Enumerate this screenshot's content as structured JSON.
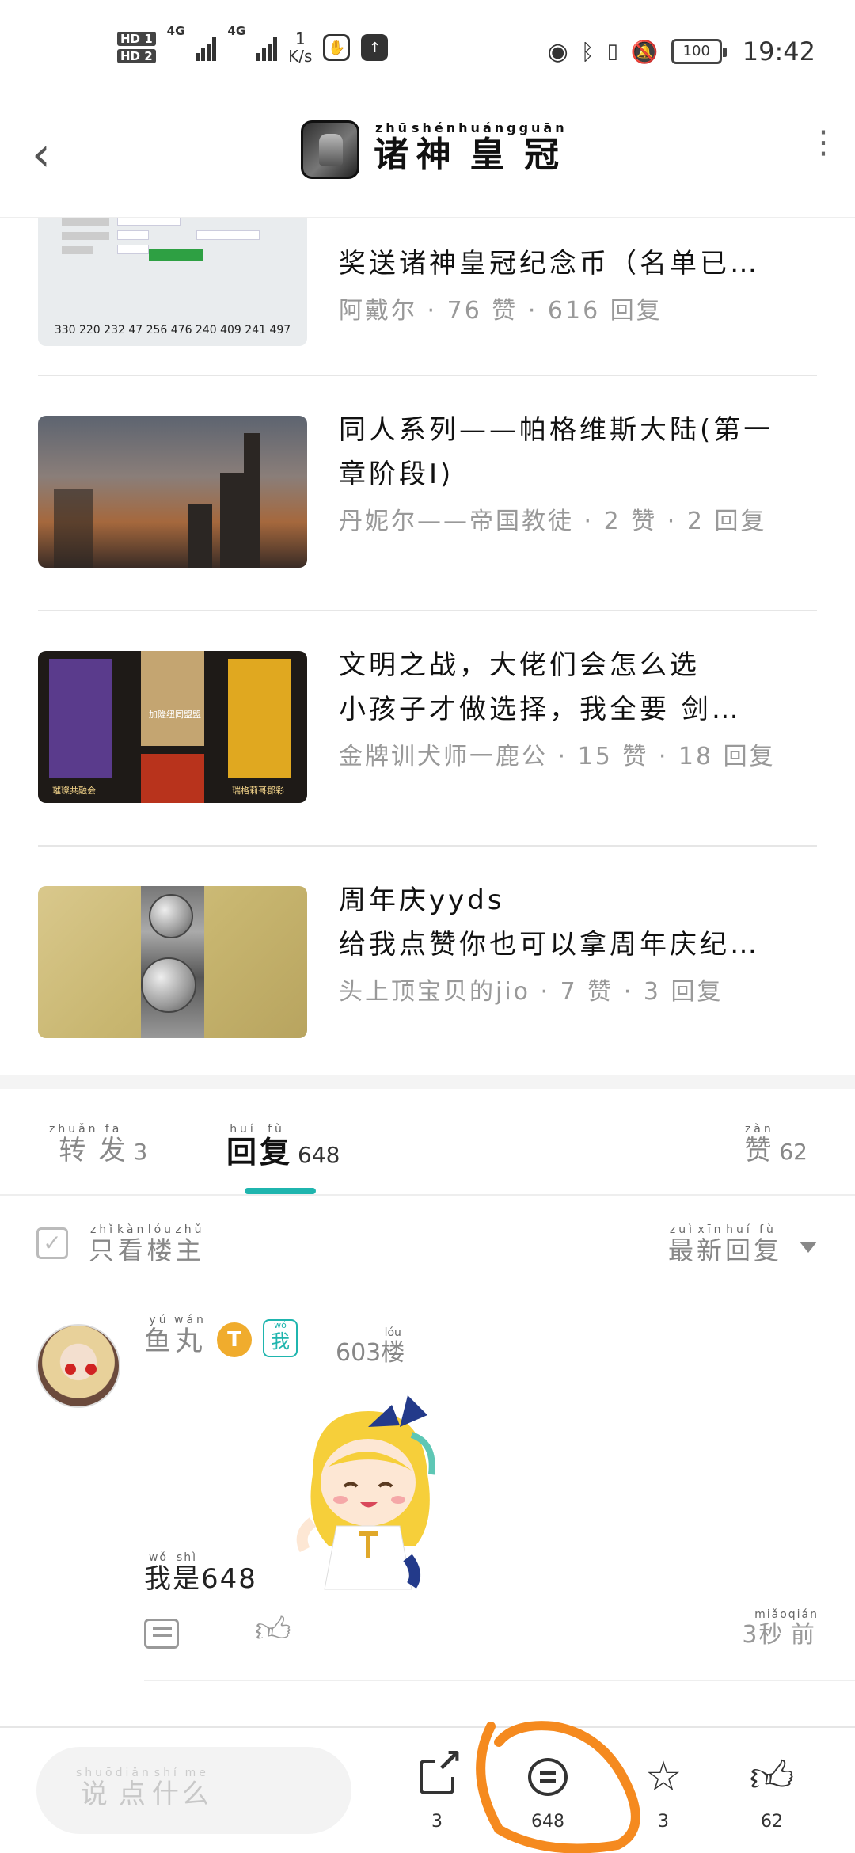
{
  "status_bar": {
    "hd1": "HD 1",
    "hd2": "HD 2",
    "net1": "4G",
    "net2": "4G",
    "speed_value": "1",
    "speed_unit": "K/s",
    "battery": "100",
    "time": "19:42"
  },
  "header": {
    "title": [
      {
        "char": "诸",
        "py": "zhū"
      },
      {
        "char": "神",
        "py": "shén"
      },
      {
        "char": "皇",
        "py": "huáng"
      },
      {
        "char": "冠",
        "py": "guān"
      }
    ]
  },
  "posts": [
    {
      "line1": "奖送诸神皇冠纪念币（名单已…",
      "meta": "阿戴尔 · 76 赞 · 616 回复",
      "thumb_numbers": "330 220 232 47 256 476 240 409 241 497"
    },
    {
      "line1": "同人系列——帕格维斯大陆(第一",
      "line2": "章阶段Ⅰ)",
      "meta": "丹妮尔——帝国教徒 · 2 赞 · 2 回复"
    },
    {
      "line1": "文明之战，大佬们会怎么选",
      "line2": "小孩子才做选择，我全要 剑…",
      "meta": "金牌训犬师一鹿公 · 15 赞 · 18 回复",
      "banner_labels": [
        "加隆纽同盟盟",
        "璀璨共融会",
        "瑞格莉哥郡彩"
      ]
    },
    {
      "line1": "周年庆yyds",
      "line2": "给我点赞你也可以拿周年庆纪…",
      "meta": "头上顶宝贝的jio · 7 赞 · 3 回复"
    }
  ],
  "tabs": [
    {
      "label": "转发",
      "py": [
        "zhuǎn",
        "fā"
      ],
      "count": "3"
    },
    {
      "label": "回复",
      "py": [
        "huí",
        "fù"
      ],
      "count": "648"
    },
    {
      "label": "赞",
      "py": [
        "zàn"
      ],
      "count": "62"
    }
  ],
  "filter": {
    "only_op": "只看楼主",
    "only_op_py": [
      "zhǐ",
      "kàn",
      "lóu",
      "zhǔ"
    ],
    "sort": "最新回复",
    "sort_py": [
      "zuì",
      "xīn",
      "huí",
      "fù"
    ]
  },
  "reply": {
    "name": "鱼丸",
    "name_py": [
      "yú",
      "wán"
    ],
    "badge_t": "T",
    "badge_me": "我",
    "badge_me_py": "wǒ",
    "floor_num": "603",
    "floor_char": "楼",
    "floor_py": "lóu",
    "text_chars": "我是",
    "text_py": [
      "wǒ",
      "shì"
    ],
    "text_num": "648",
    "time_num": "3",
    "time_chars": "秒前",
    "time_py": [
      "miǎo",
      "qián"
    ]
  },
  "bottom_bar": {
    "placeholder": "说点什么",
    "placeholder_py": [
      "shuō",
      "diǎn",
      "shí",
      "me"
    ],
    "share_count": "3",
    "comment_count": "648",
    "favorite_count": "3",
    "like_count": "62"
  },
  "colors": {
    "accent": "#1fb5ae",
    "annotation": "#f58a1f",
    "badge_gold": "#f0ac2d"
  }
}
